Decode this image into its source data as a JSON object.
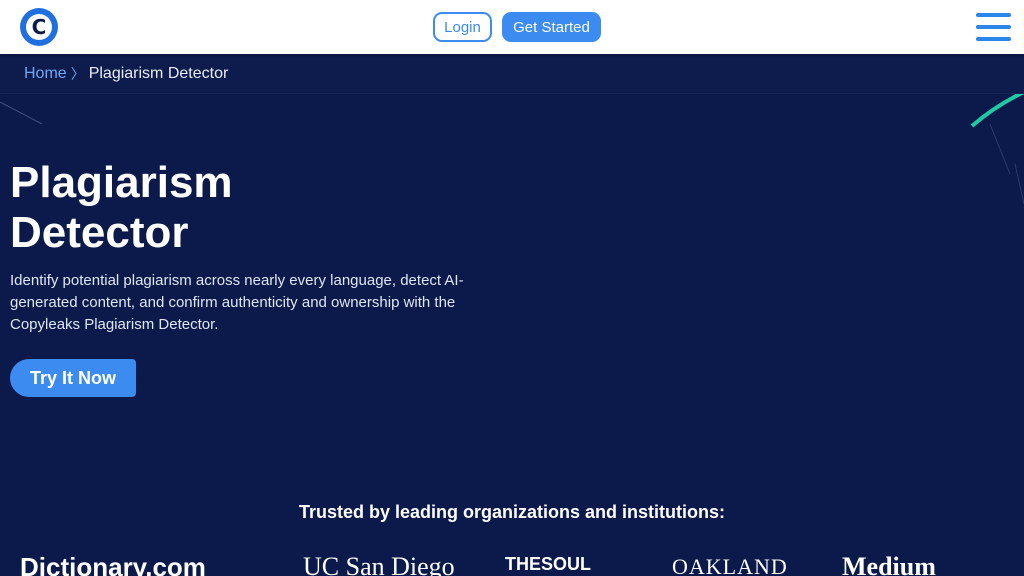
{
  "header": {
    "logo_letter": "C",
    "login_label": "Login",
    "get_started_label": "Get Started"
  },
  "breadcrumb": {
    "home": "Home",
    "separator": "〉",
    "current": "Plagiarism Detector"
  },
  "hero": {
    "title_line1": "Plagiarism",
    "title_line2": "Detector",
    "description": "Identify potential plagiarism across nearly every language, detect AI-generated content, and confirm authenticity and ownership with the Copyleaks Plagiarism Detector.",
    "cta_label": "Try It Now"
  },
  "trusted": {
    "heading": "Trusted by leading organizations and institutions:",
    "logos": [
      {
        "name": "dictionary-logo",
        "text": "Dictionary.com"
      },
      {
        "name": "ucsd-logo",
        "text": "UC San Diego"
      },
      {
        "name": "soul-publishing-logo",
        "text": "THESOUL"
      },
      {
        "name": "oakland-logo",
        "text": "OAKLAND"
      },
      {
        "name": "medium-logo",
        "text": "Medium"
      }
    ]
  },
  "colors": {
    "accent": "#3b8bf0",
    "background": "#0b1a4a",
    "decor_green": "#1fc9a3"
  }
}
